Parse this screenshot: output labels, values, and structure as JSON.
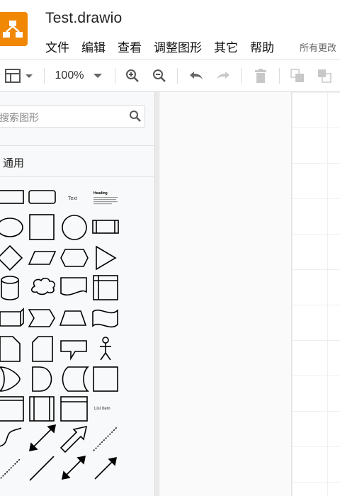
{
  "app": {
    "document_title": "Test.drawio",
    "logo_icon": "drawio-logo-icon",
    "brand_color": "#f08705"
  },
  "menu": {
    "items": [
      "文件",
      "编辑",
      "查看",
      "调整图形",
      "其它",
      "帮助"
    ],
    "save_status": "所有更改"
  },
  "toolbar": {
    "zoom": "100%",
    "icons": [
      "format-panel-icon",
      "zoom-in-icon",
      "zoom-out-icon",
      "undo-icon",
      "redo-icon",
      "delete-icon",
      "to-front-icon",
      "to-back-icon"
    ]
  },
  "sidebar": {
    "search_placeholder": "搜索图形",
    "section_title": "通用",
    "shape_labels": {
      "text": "Text",
      "heading": "Heading",
      "list_item": "List Item"
    }
  }
}
